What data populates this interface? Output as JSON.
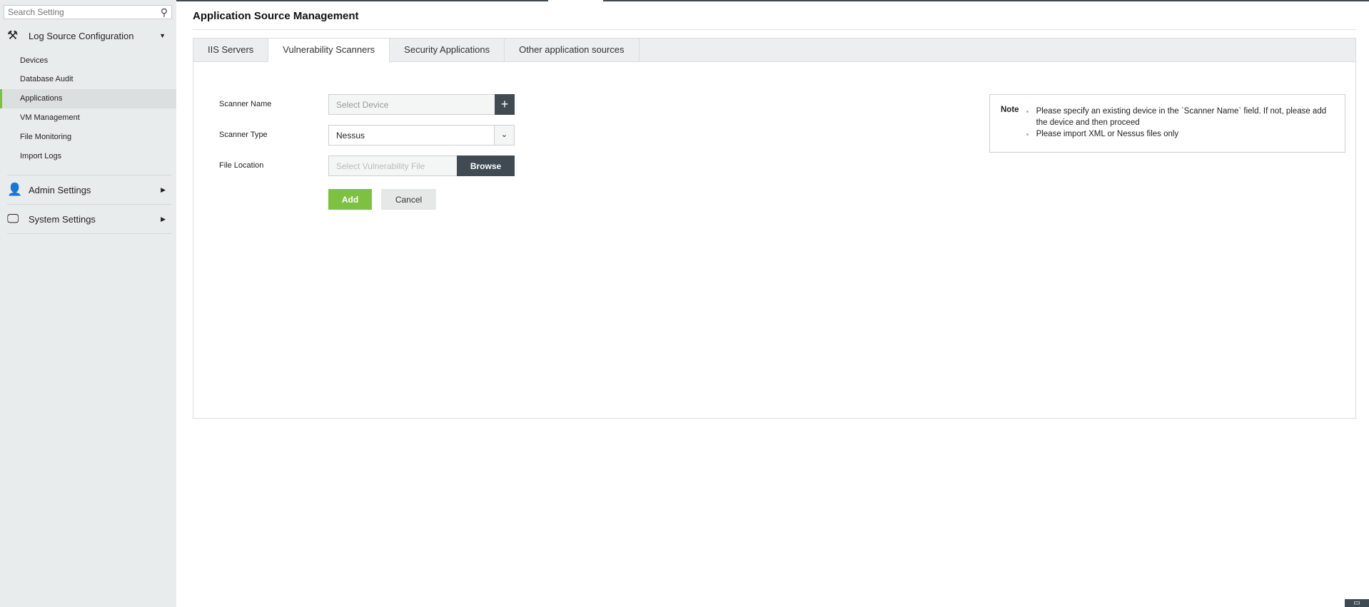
{
  "sidebar": {
    "search_placeholder": "Search Setting",
    "groups": [
      {
        "label": "Log Source Configuration",
        "icon": "tools-icon",
        "expanded": true,
        "items": [
          {
            "label": "Devices"
          },
          {
            "label": "Database Audit"
          },
          {
            "label": "Applications",
            "active": true
          },
          {
            "label": "VM Management"
          },
          {
            "label": "File Monitoring"
          },
          {
            "label": "Import Logs"
          }
        ]
      },
      {
        "label": "Admin Settings",
        "icon": "admin-settings-icon"
      },
      {
        "label": "System Settings",
        "icon": "system-settings-icon"
      }
    ]
  },
  "main": {
    "title": "Application Source Management",
    "tabs": [
      {
        "label": "IIS Servers"
      },
      {
        "label": "Vulnerability Scanners",
        "active": true
      },
      {
        "label": "Security Applications"
      },
      {
        "label": "Other application sources"
      }
    ],
    "form": {
      "scanner_name_label": "Scanner Name",
      "scanner_name_placeholder": "Select Device",
      "scanner_type_label": "Scanner Type",
      "scanner_type_value": "Nessus",
      "file_location_label": "File Location",
      "file_location_placeholder": "Select Vulnerability File",
      "browse_label": "Browse",
      "add_label": "Add",
      "cancel_label": "Cancel"
    },
    "note": {
      "title": "Note",
      "items": [
        "Please specify an existing device in the `Scanner Name` field. If not, please add the device and then proceed",
        "Please import XML or Nessus files only"
      ]
    }
  },
  "colors": {
    "accent": "#7dc042",
    "dark": "#3f4a52"
  }
}
